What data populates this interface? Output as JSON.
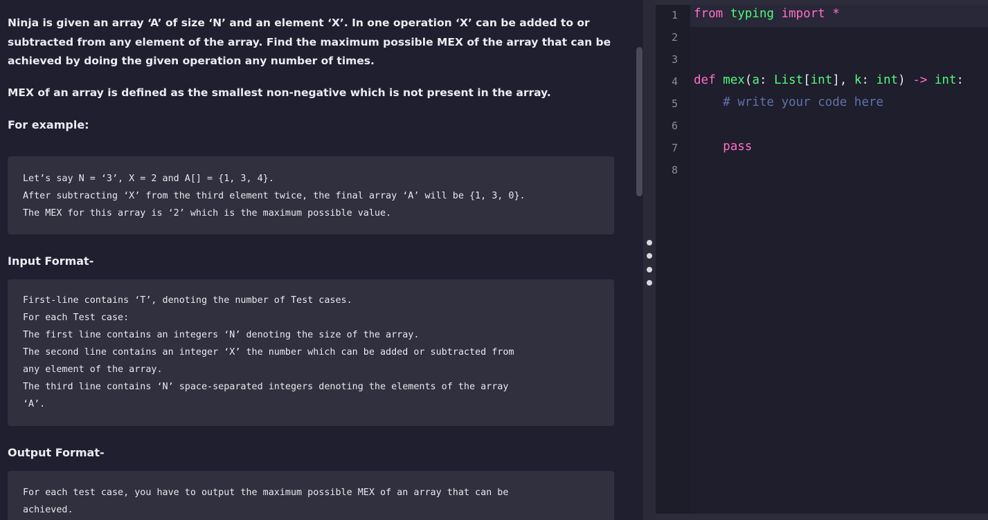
{
  "problem": {
    "statement_lines": [
      "Ninja is given an array ‘A’ of size ‘N’ and an element ‘X’. In one operation ‘X’ can be added to or",
      "subtracted from any element of the array. Find the maximum possible MEX of the array that can be",
      "achieved by doing the given operation any number of times."
    ],
    "mex_definition": "MEX of an array is defined as the smallest non-negative which is not present in the array.",
    "example_heading": "For example:",
    "example_lines": [
      "Let’s say N = ‘3’, X = 2 and A[] = {1, 3, 4}.",
      "After subtracting ‘X’ from the third element twice, the final array ‘A’ will be {1, 3, 0}.",
      "The MEX for this array is ‘2’ which is the maximum possible value."
    ],
    "input_heading": "Input Format-",
    "input_lines": [
      "First-line contains ‘T’, denoting the number of Test cases.",
      "For each Test case:",
      "The first line contains an integers ‘N’ denoting the size of the array.",
      "The second line contains an integer ‘X’ the number which can be added or subtracted from",
      "any element of the array.",
      "The third line contains ‘N’ space-separated integers denoting the elements of the array",
      "‘A’."
    ],
    "output_heading": "Output Format-",
    "output_lines": [
      "For each test case, you have to output the maximum possible MEX of an array that can be",
      "achieved."
    ]
  },
  "editor": {
    "line_numbers": [
      "1",
      "2",
      "3",
      "4",
      "5",
      "6",
      "7",
      "8"
    ],
    "tokens": {
      "l1_from": "from",
      "l1_module": "typing",
      "l1_import": "import",
      "l1_star": "*",
      "l4_def": "def",
      "l4_name": "mex",
      "l4_open": "(",
      "l4_param_a": "a",
      "l4_colon1": ": ",
      "l4_list": "List",
      "l4_lbr": "[",
      "l4_int1": "int",
      "l4_rbr": "], ",
      "l4_param_k": "k",
      "l4_colon2": ": ",
      "l4_int2": "int",
      "l4_close": ")",
      "l4_arrow": "->",
      "l4_int3": "int",
      "l4_colon3": ":",
      "l5_comment": "# write your code here",
      "l7_pass": "pass"
    }
  }
}
